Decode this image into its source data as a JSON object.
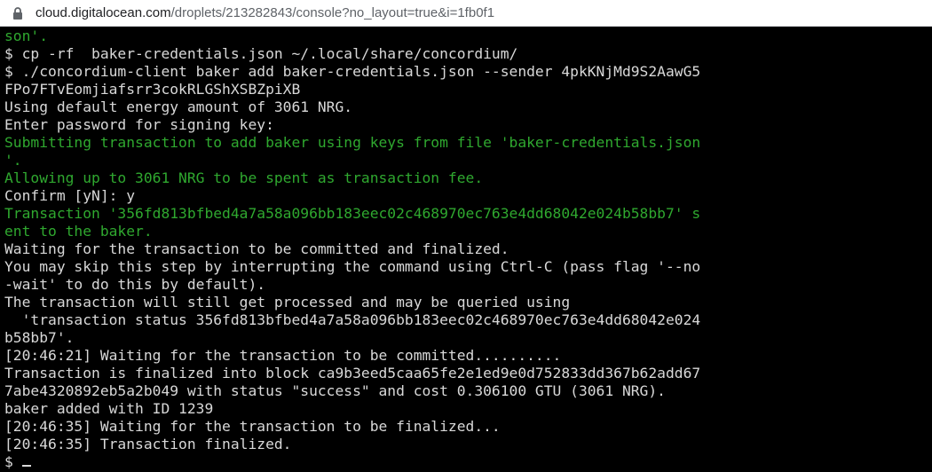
{
  "browser": {
    "url_host": "cloud.digitalocean.com",
    "url_path": "/droplets/213282843/console?no_layout=true&i=1fb0f1",
    "lock_icon": "lock-icon"
  },
  "colors": {
    "terminal_bg": "#000000",
    "text_default": "#d8d8d8",
    "text_green": "#2fa82f"
  },
  "terminal": {
    "lines": [
      {
        "text": "son'.",
        "color": "green"
      },
      {
        "text": "$ cp -rf  baker-credentials.json ~/.local/share/concordium/",
        "color": "default"
      },
      {
        "text": "$ ./concordium-client baker add baker-credentials.json --sender 4pkKNjMd9S2AawG5",
        "color": "default"
      },
      {
        "text": "FPo7FTvEomjiafsrr3cokRLGShXSBZpiXB",
        "color": "default"
      },
      {
        "text": "Using default energy amount of 3061 NRG.",
        "color": "default"
      },
      {
        "text": "Enter password for signing key:",
        "color": "default"
      },
      {
        "text": "Submitting transaction to add baker using keys from file 'baker-credentials.json",
        "color": "green"
      },
      {
        "text": "'.",
        "color": "green"
      },
      {
        "text": "Allowing up to 3061 NRG to be spent as transaction fee.",
        "color": "green"
      },
      {
        "text": "Confirm [yN]: y",
        "color": "default"
      },
      {
        "text": "Transaction '356fd813bfbed4a7a58a096bb183eec02c468970ec763e4dd68042e024b58bb7' s",
        "color": "green"
      },
      {
        "text": "ent to the baker.",
        "color": "green"
      },
      {
        "text": "Waiting for the transaction to be committed and finalized.",
        "color": "default"
      },
      {
        "text": "You may skip this step by interrupting the command using Ctrl-C (pass flag '--no",
        "color": "default"
      },
      {
        "text": "-wait' to do this by default).",
        "color": "default"
      },
      {
        "text": "The transaction will still get processed and may be queried using",
        "color": "default"
      },
      {
        "text": "  'transaction status 356fd813bfbed4a7a58a096bb183eec02c468970ec763e4dd68042e024",
        "color": "default"
      },
      {
        "text": "b58bb7'.",
        "color": "default"
      },
      {
        "text": "[20:46:21] Waiting for the transaction to be committed..........",
        "color": "default"
      },
      {
        "text": "Transaction is finalized into block ca9b3eed5caa65fe2e1ed9e0d752833dd367b62add67",
        "color": "default"
      },
      {
        "text": "7abe4320892eb5a2b049 with status \"success\" and cost 0.306100 GTU (3061 NRG).",
        "color": "default"
      },
      {
        "text": "baker added with ID 1239",
        "color": "default"
      },
      {
        "text": "[20:46:35] Waiting for the transaction to be finalized...",
        "color": "default"
      },
      {
        "text": "[20:46:35] Transaction finalized.",
        "color": "default"
      }
    ],
    "prompt": "$ "
  }
}
